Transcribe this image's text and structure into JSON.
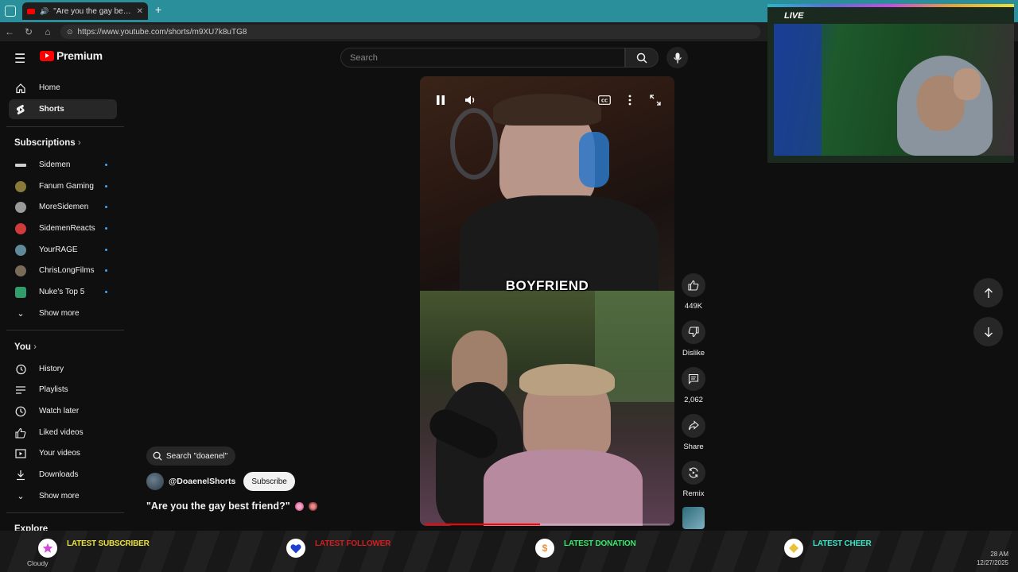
{
  "browser": {
    "tab_title": "\"Are you the gay best friend?\"",
    "new_tab_symbol": "+",
    "url": "https://www.youtube.com/shorts/m9XU7k8uTG8"
  },
  "masthead": {
    "logo_text": "Premium",
    "search_placeholder": "Search"
  },
  "sidebar": {
    "main": [
      {
        "label": "Home",
        "icon": "home-icon"
      },
      {
        "label": "Shorts",
        "icon": "shorts-icon",
        "active": true
      }
    ],
    "subscriptions_header": "Subscriptions",
    "subscriptions": [
      {
        "label": "Sidemen",
        "color": "#cfcfcf"
      },
      {
        "label": "Fanum Gaming",
        "color": "#8a7a3a"
      },
      {
        "label": "MoreSidemen",
        "color": "#9a9a9a"
      },
      {
        "label": "SidemenReacts",
        "color": "#d03a3a"
      },
      {
        "label": "YourRAGE",
        "color": "#5f8a9a"
      },
      {
        "label": "ChrisLongFilms",
        "color": "#7a6a5a"
      },
      {
        "label": "Nuke's Top 5",
        "color": "#2f9e6a"
      }
    ],
    "show_more": "Show more",
    "you_header": "You",
    "you_items": [
      {
        "label": "History",
        "icon": "history-icon"
      },
      {
        "label": "Playlists",
        "icon": "playlists-icon"
      },
      {
        "label": "Watch later",
        "icon": "clock-icon"
      },
      {
        "label": "Liked videos",
        "icon": "thumbs-up-icon"
      },
      {
        "label": "Your videos",
        "icon": "video-icon"
      },
      {
        "label": "Downloads",
        "icon": "download-icon"
      }
    ],
    "show_more_2": "Show more",
    "explore_header": "Explore"
  },
  "short": {
    "caption": "BOYFRIEND",
    "progress": 0.47,
    "search_chip": "Search \"doaenel\"",
    "channel": "@DoaenelShorts",
    "subscribe_label": "Subscribe",
    "title": "\"Are you the gay best friend?\"",
    "actions": {
      "like_count": "449K",
      "dislike_label": "Dislike",
      "comment_count": "2,062",
      "share_label": "Share",
      "remix_label": "Remix"
    }
  },
  "overlay": {
    "live_label": "LIVE",
    "alerts": [
      {
        "label": "LATEST SUBSCRIBER",
        "color": "#e8e23a",
        "icon": "star-icon",
        "icon_color": "#d04bd8"
      },
      {
        "label": "LATEST FOLLOWER",
        "color": "#d21f1f",
        "icon": "heart-icon",
        "icon_color": "#1f3fd2"
      },
      {
        "label": "LATEST DONATION",
        "color": "#37e86a",
        "icon": "dollar-icon",
        "icon_color": "#e8903a"
      },
      {
        "label": "LATEST CHEER",
        "color": "#37e8c7",
        "icon": "diamond-icon",
        "icon_color": "#e8c23a"
      }
    ]
  },
  "taskbar": {
    "weather": "Cloudy",
    "time": "28 AM",
    "date": "12/27/2025"
  }
}
